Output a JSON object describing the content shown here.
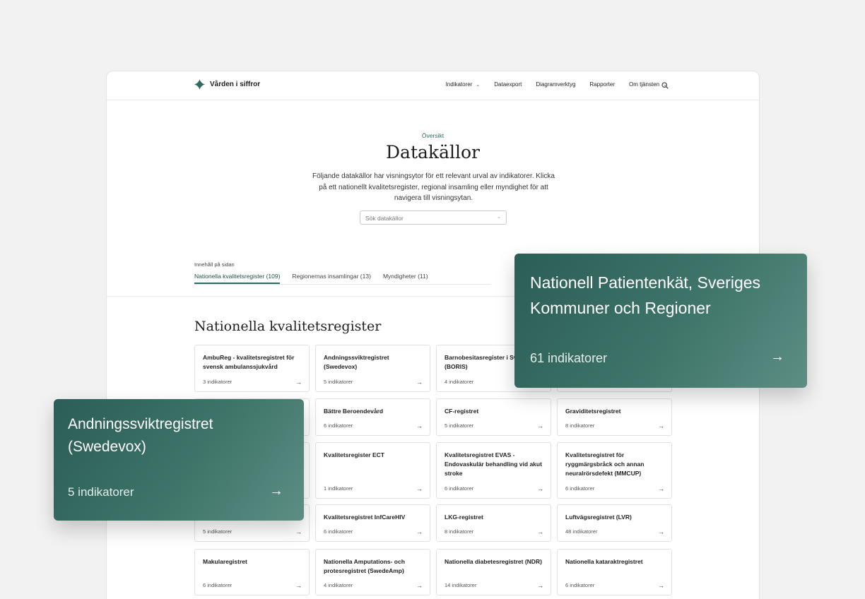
{
  "nav": {
    "logo_text": "Vården i siffror",
    "links": [
      {
        "label": "Indikatorer",
        "has_dropdown": true
      },
      {
        "label": "Dataexport",
        "has_dropdown": false
      },
      {
        "label": "Diagramverktyg",
        "has_dropdown": false
      },
      {
        "label": "Rapporter",
        "has_dropdown": false
      },
      {
        "label": "Om tjänsten",
        "has_dropdown": true
      }
    ],
    "search_icon": "search-icon"
  },
  "header": {
    "eyebrow": "Översikt",
    "title": "Datakällor",
    "intro": "Följande datakällor har visningsytor för ett relevant urval av indikatorer. Klicka på ett nationellt kvalitetsregister, regional insamling eller myndighet för att navigera till visningsytan.",
    "search_placeholder": "Sök datakällor"
  },
  "toc": {
    "label": "Innehåll på sidan",
    "tabs": [
      {
        "label": "Nationella kvalitetsregister (109)",
        "active": true
      },
      {
        "label": "Regionernas insamlingar (13)",
        "active": false
      },
      {
        "label": "Myndigheter (11)",
        "active": false
      }
    ]
  },
  "section": {
    "title": "Nationella kvalitetsregister"
  },
  "cards": [
    {
      "title": "AmbuReg - kvalitetsregistret för svensk ambulanssjukvård",
      "count": "3 indikatorer"
    },
    {
      "title": "Andningssviktregistret (Swedevox)",
      "count": "5 indikatorer"
    },
    {
      "title": "Barnobesitasregister i Sverige (BORIS)",
      "count": "4 indikatorer"
    },
    {
      "title": "",
      "count": ""
    },
    {
      "title": "",
      "count": ""
    },
    {
      "title": "Bättre Beroendevård",
      "count": "6 indikatorer"
    },
    {
      "title": "CF-registret",
      "count": "5 indikatorer"
    },
    {
      "title": "Graviditetsregistret",
      "count": "8 indikatorer"
    },
    {
      "title": "",
      "count": ""
    },
    {
      "title": "Kvalitetsregister ECT",
      "count": "1 indikatorer"
    },
    {
      "title": "Kvalitetsregistret EVAS - Endovaskulär behandling vid akut stroke",
      "count": "6 indikatorer"
    },
    {
      "title": "Kvalitetsregistret för ryggmärgsbråck och annan neuralrörsdefekt (MMCUP)",
      "count": "6 indikatorer"
    },
    {
      "title": "",
      "count": "5 indikatorer"
    },
    {
      "title": "Kvalitetsregistret InfCareHIV",
      "count": "6 indikatorer"
    },
    {
      "title": "LKG-registret",
      "count": "8 indikatorer"
    },
    {
      "title": "Luftvägsregistret (LVR)",
      "count": "48 indikatorer"
    },
    {
      "title": "Makularegistret",
      "count": "6 indikatorer"
    },
    {
      "title": "Nationella Amputations- och protesregistret (SwedeAmp)",
      "count": "4 indikatorer"
    },
    {
      "title": "Nationella diabetesregistret (NDR)",
      "count": "14 indikatorer"
    },
    {
      "title": "Nationella kataraktregistret",
      "count": "6 indikatorer"
    }
  ],
  "highlight_right": {
    "title": "Nationell Patientenkät, Sveriges Kommuner och Regioner",
    "count": "61 indikatorer"
  },
  "highlight_left": {
    "title": "Andningssviktregistret (Swedevox)",
    "count": "5 indikatorer"
  },
  "colors": {
    "accent": "#2f6b5f",
    "highlight_start": "#2b5e56",
    "highlight_end": "#5d8e85",
    "background": "#f2f2f2"
  }
}
